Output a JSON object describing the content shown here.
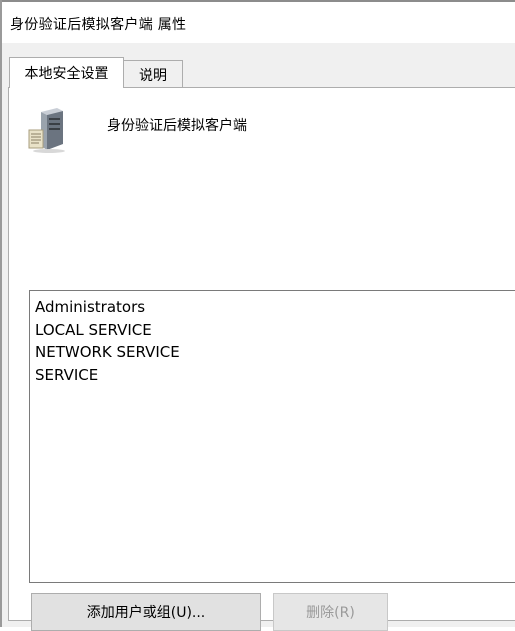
{
  "window": {
    "title": "身份验证后模拟客户端 属性"
  },
  "tabs": [
    {
      "label": "本地安全设置",
      "active": true
    },
    {
      "label": "说明",
      "active": false
    }
  ],
  "policy": {
    "name": "身份验证后模拟客户端",
    "icon": "server-icon"
  },
  "accounts": [
    "Administrators",
    "LOCAL SERVICE",
    "NETWORK SERVICE",
    "SERVICE"
  ],
  "buttons": {
    "add_label": "添加用户或组(U)...",
    "remove_label": "删除(R)",
    "remove_enabled": false
  }
}
